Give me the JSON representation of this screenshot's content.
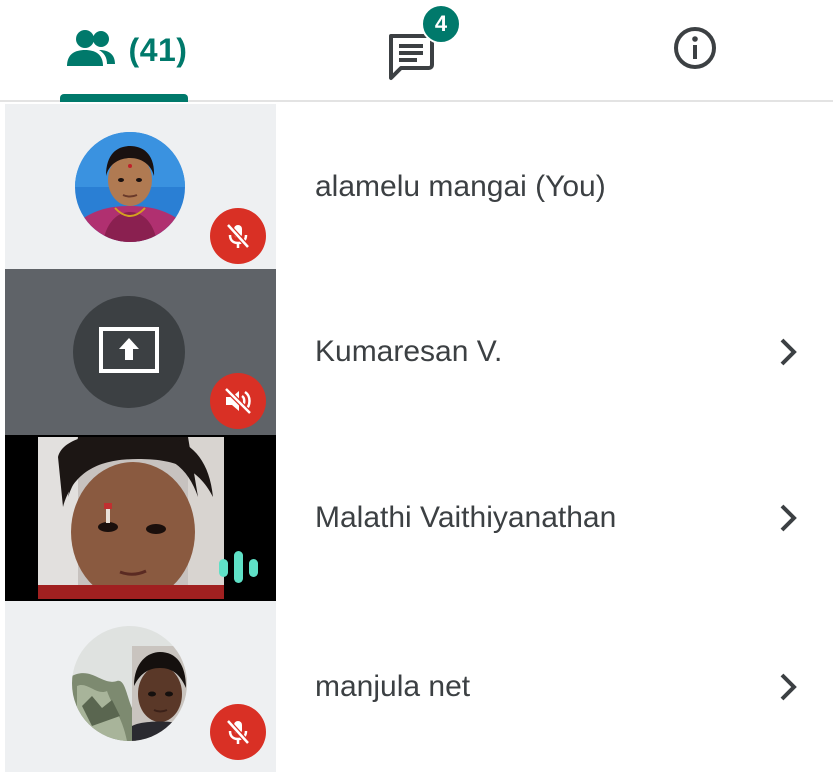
{
  "tabs": {
    "people": {
      "icon": "people-icon",
      "count_label": "(41)"
    },
    "chat": {
      "icon": "chat-icon",
      "badge": "4"
    },
    "info": {
      "icon": "info-icon"
    }
  },
  "colors": {
    "accent": "#00796b",
    "mute_red": "#d93025",
    "audio_teal": "#5fe0c6",
    "text": "#3c4043"
  },
  "participants": [
    {
      "name": "alamelu mangai (You)",
      "tile": "avatar-photo",
      "status_icon": "mic-off-icon",
      "has_chevron": false
    },
    {
      "name": "Kumaresan V.",
      "tile": "presenting-screen",
      "status_icon": "volume-off-icon",
      "has_chevron": true
    },
    {
      "name": "Malathi Vaithiyanathan",
      "tile": "camera-video",
      "status_icon": "audio-level-icon",
      "has_chevron": true
    },
    {
      "name": "manjula net",
      "tile": "avatar-photo",
      "status_icon": "mic-off-icon",
      "has_chevron": true
    }
  ]
}
